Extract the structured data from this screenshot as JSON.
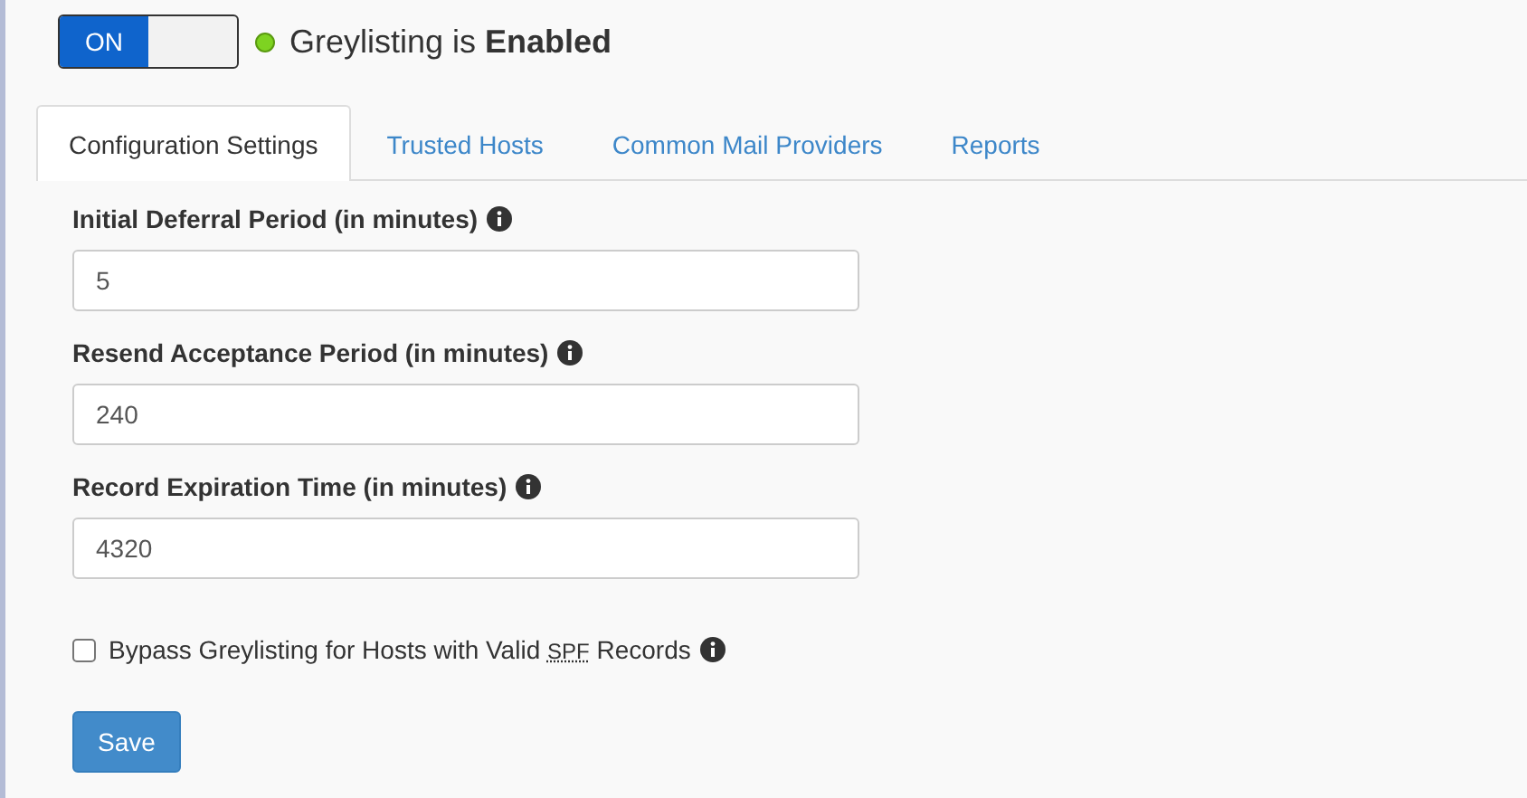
{
  "toggle": {
    "label": "ON",
    "on": true
  },
  "status": {
    "text": "Greylisting is **Enabled**",
    "color": "#7ed321"
  },
  "tabs": [
    {
      "label": "Configuration Settings",
      "selected": true
    },
    {
      "label": "Trusted Hosts",
      "selected": false
    },
    {
      "label": "Common Mail Providers",
      "selected": false
    },
    {
      "label": "Reports",
      "selected": false
    }
  ],
  "fields": [
    {
      "label": "Initial Deferral Period (in minutes)",
      "value": "5"
    },
    {
      "label": "Resend Acceptance Period (in minutes)",
      "value": "240"
    },
    {
      "label": "Record Expiration Time (in minutes)",
      "value": "4320"
    }
  ],
  "bypass": {
    "label_before": "Bypass Greylisting for Hosts with Valid",
    "abbr": "SPF",
    "label_after": "Records",
    "checked": false
  },
  "save_button": "Save"
}
